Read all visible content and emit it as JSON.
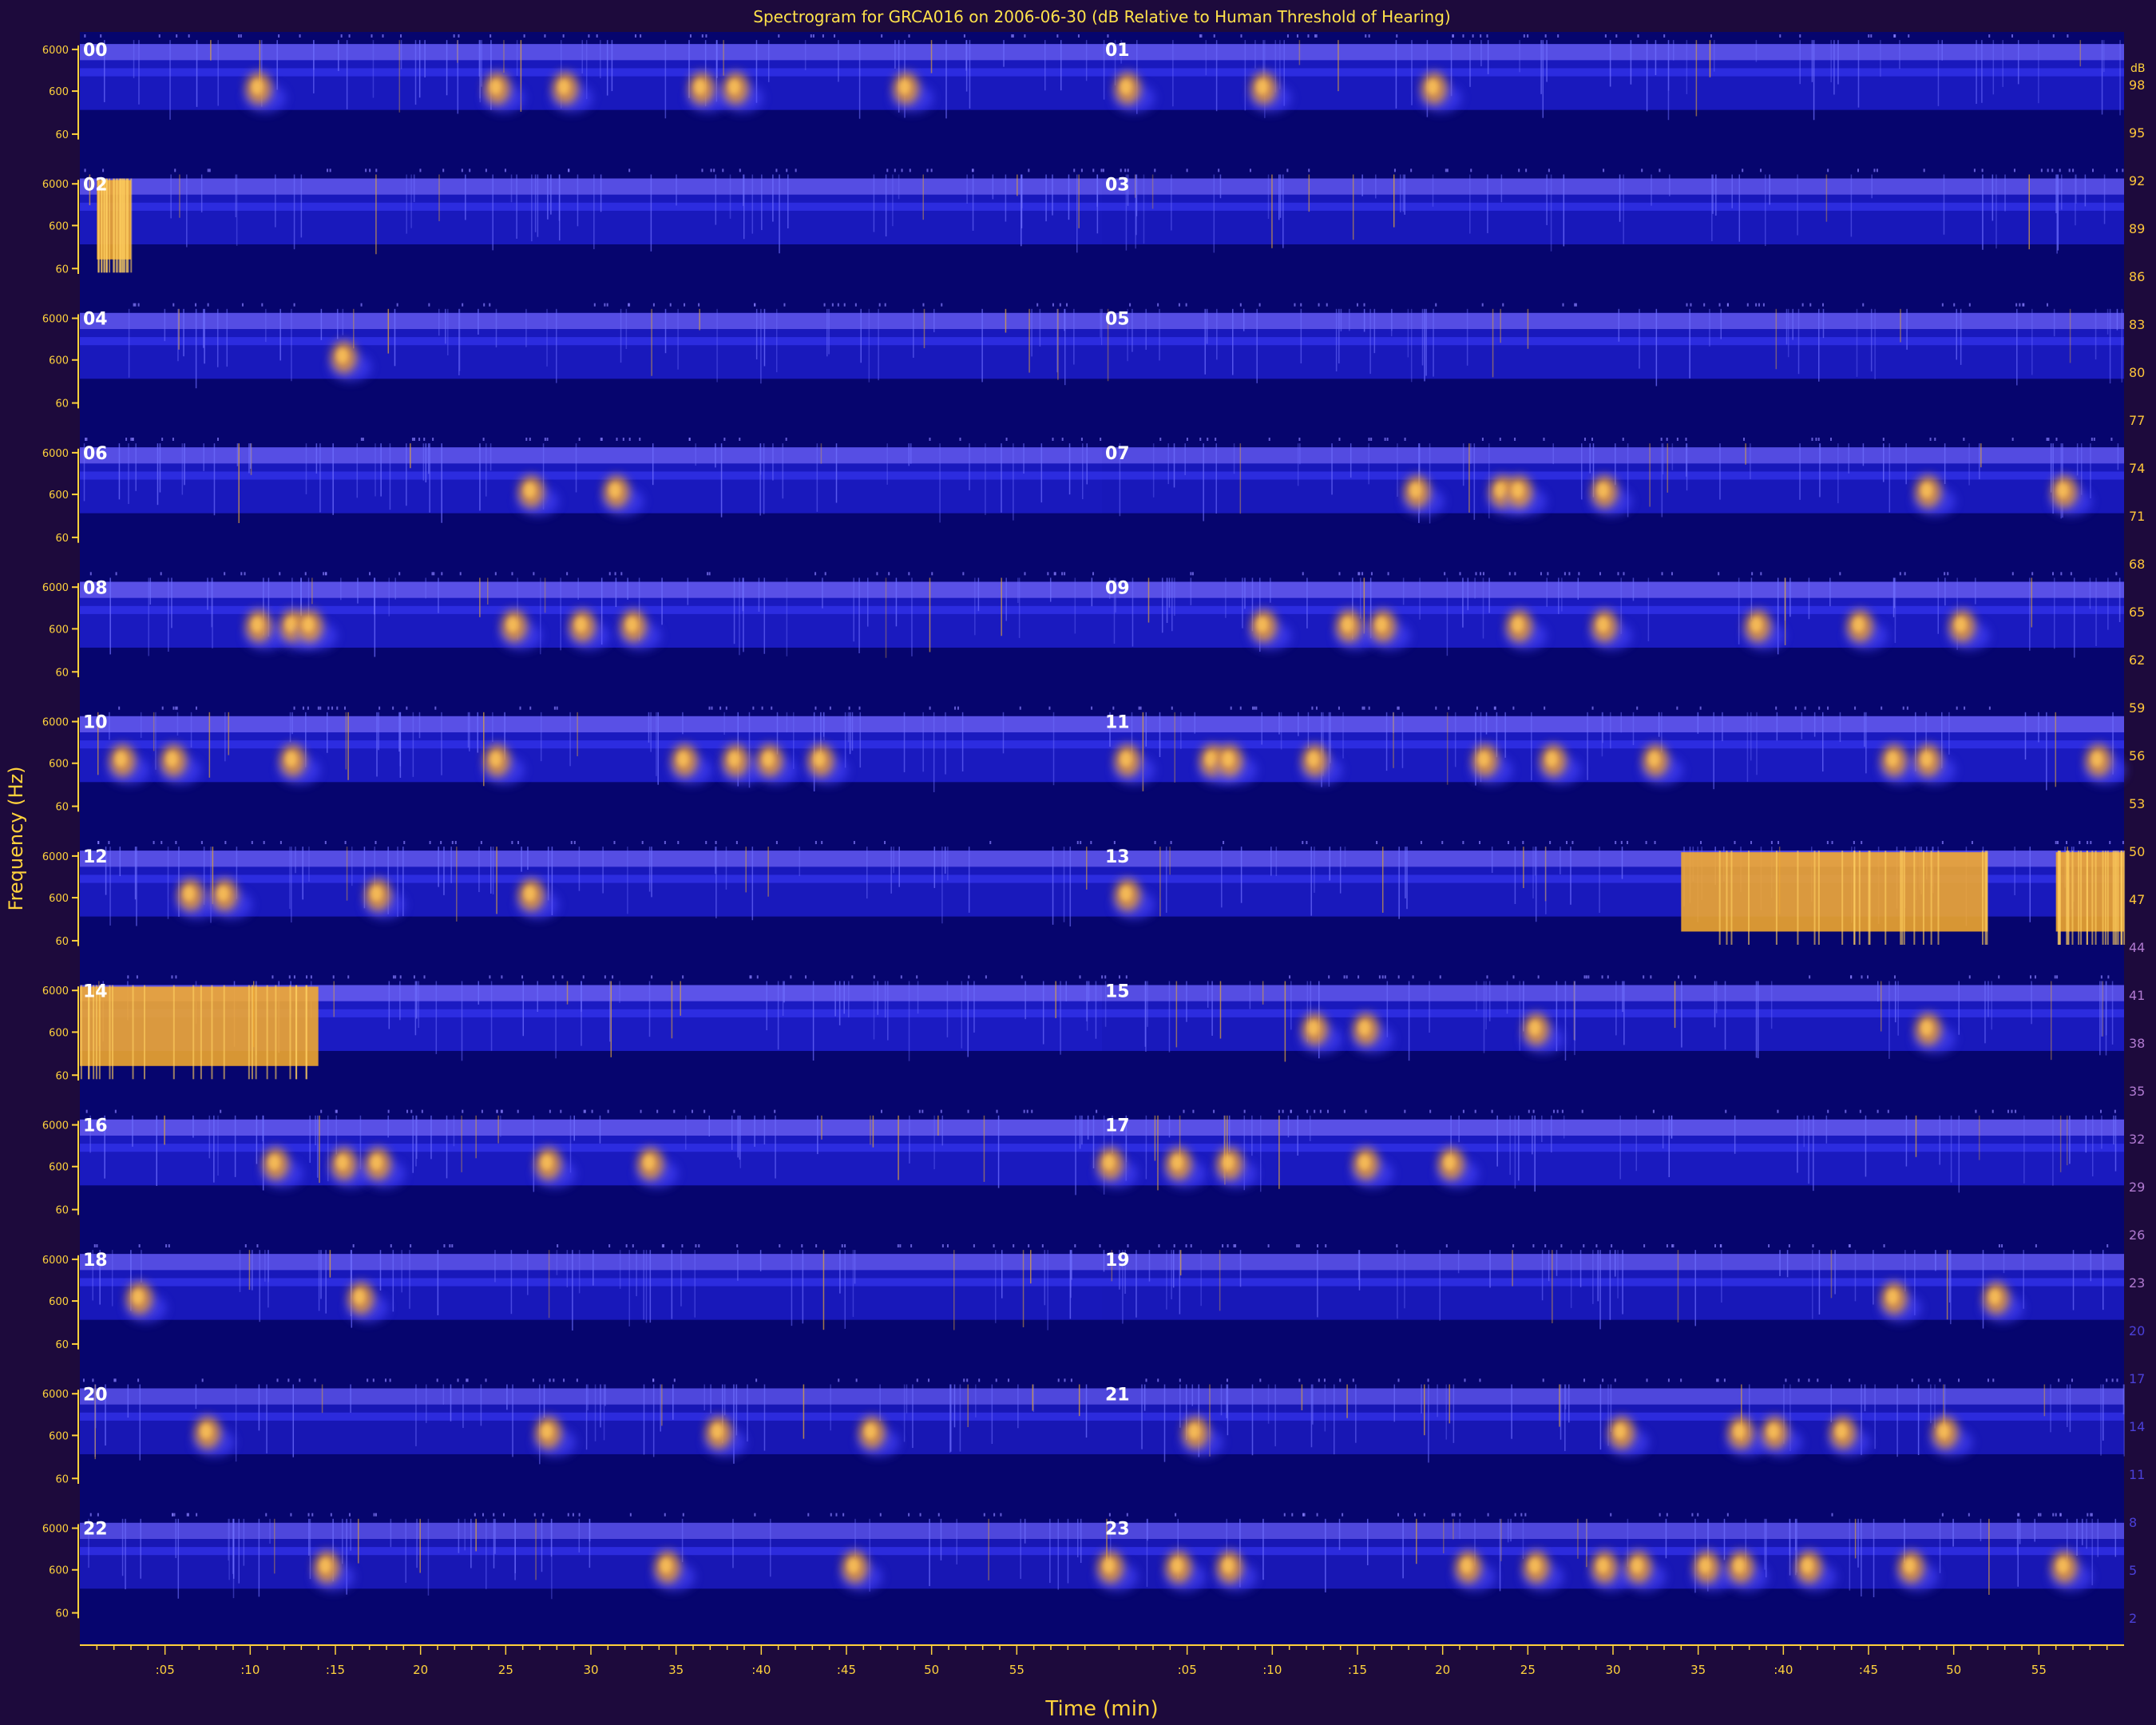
{
  "chart_data": {
    "type": "heatmap",
    "title": "Spectrogram for GRCA016 on 2006-06-30 (dB Relative to Human Threshold of Hearing)",
    "xlabel": "Time (min)",
    "ylabel": "Frequency (Hz)",
    "colorbar_label": "dB",
    "freq_ticks": [
      "6000",
      "600",
      "60"
    ],
    "time_ticks": [
      ":05",
      ":10",
      ":15",
      "20",
      "25",
      "30",
      "35",
      ":40",
      ":45",
      "50",
      "55"
    ],
    "hour_labels": [
      "00",
      "01",
      "02",
      "03",
      "04",
      "05",
      "06",
      "07",
      "08",
      "09",
      "10",
      "11",
      "12",
      "13",
      "14",
      "15",
      "16",
      "17",
      "18",
      "19",
      "20",
      "21",
      "22",
      "23"
    ],
    "hours_per_row": 2,
    "x_range_min": [
      0,
      60
    ],
    "colorbar_ticks": [
      98,
      95,
      92,
      89,
      86,
      83,
      80,
      77,
      74,
      71,
      68,
      65,
      62,
      59,
      56,
      53,
      50,
      47,
      44,
      41,
      38,
      35,
      32,
      29,
      26,
      23,
      20,
      17,
      14,
      11,
      8,
      5,
      2
    ],
    "hours": [
      {
        "hour": "00",
        "band": 0.55,
        "calls": [
          10,
          24,
          28,
          36,
          38,
          48
        ],
        "loud": []
      },
      {
        "hour": "01",
        "band": 0.55,
        "calls": [
          1,
          9,
          19
        ],
        "loud": []
      },
      {
        "hour": "02",
        "band": 0.5,
        "calls": [],
        "loud": [
          [
            1,
            3
          ]
        ]
      },
      {
        "hour": "03",
        "band": 0.45,
        "calls": [],
        "loud": []
      },
      {
        "hour": "04",
        "band": 0.5,
        "calls": [
          15
        ],
        "loud": []
      },
      {
        "hour": "05",
        "band": 0.5,
        "calls": [],
        "loud": []
      },
      {
        "hour": "06",
        "band": 0.55,
        "calls": [
          26,
          31
        ],
        "loud": []
      },
      {
        "hour": "07",
        "band": 0.45,
        "calls": [
          18,
          23,
          24,
          29,
          48,
          56
        ],
        "loud": []
      },
      {
        "hour": "08",
        "band": 0.6,
        "calls": [
          10,
          12,
          13,
          25,
          29,
          32
        ],
        "loud": []
      },
      {
        "hour": "09",
        "band": 0.6,
        "calls": [
          9,
          14,
          16,
          24,
          29,
          38,
          44,
          50
        ],
        "loud": []
      },
      {
        "hour": "10",
        "band": 0.6,
        "calls": [
          2,
          5,
          12,
          24,
          35,
          38,
          40,
          43
        ],
        "loud": []
      },
      {
        "hour": "11",
        "band": 0.6,
        "calls": [
          1,
          6,
          7,
          12,
          22,
          26,
          32,
          46,
          48,
          58
        ],
        "loud": []
      },
      {
        "hour": "12",
        "band": 0.5,
        "calls": [
          6,
          8,
          17,
          26
        ],
        "loud": []
      },
      {
        "hour": "13",
        "band": 0.5,
        "calls": [
          1
        ],
        "loud": [
          [
            34,
            52
          ],
          [
            56,
            60
          ]
        ]
      },
      {
        "hour": "14",
        "band": 0.7,
        "calls": [],
        "loud": [
          [
            0,
            14
          ]
        ]
      },
      {
        "hour": "15",
        "band": 0.5,
        "calls": [
          12,
          15,
          25,
          48
        ],
        "loud": []
      },
      {
        "hour": "16",
        "band": 0.6,
        "calls": [
          11,
          15,
          17,
          27,
          33
        ],
        "loud": []
      },
      {
        "hour": "17",
        "band": 0.6,
        "calls": [
          0,
          4,
          7,
          15,
          20
        ],
        "loud": []
      },
      {
        "hour": "18",
        "band": 0.45,
        "calls": [
          3,
          16
        ],
        "loud": []
      },
      {
        "hour": "19",
        "band": 0.4,
        "calls": [
          46,
          52
        ],
        "loud": []
      },
      {
        "hour": "20",
        "band": 0.3,
        "calls": [
          7,
          27,
          37,
          46
        ],
        "loud": []
      },
      {
        "hour": "21",
        "band": 0.3,
        "calls": [
          5,
          30,
          37,
          39,
          43,
          49
        ],
        "loud": []
      },
      {
        "hour": "22",
        "band": 0.3,
        "calls": [
          14,
          34,
          45
        ],
        "loud": []
      },
      {
        "hour": "23",
        "band": 0.3,
        "calls": [
          0,
          4,
          7,
          21,
          25,
          29,
          31,
          35,
          37,
          41,
          47,
          56
        ],
        "loud": []
      }
    ]
  }
}
